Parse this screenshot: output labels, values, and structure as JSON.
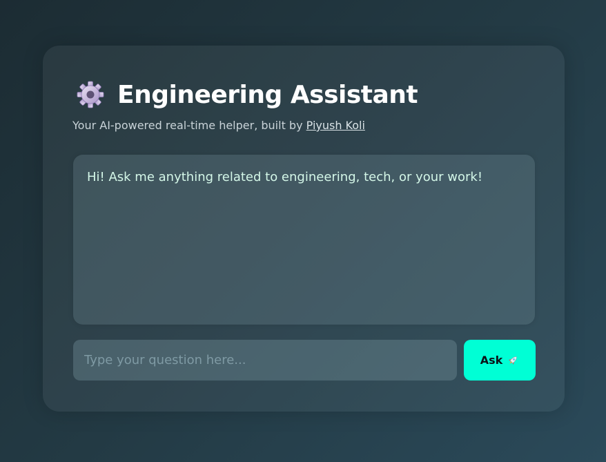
{
  "header": {
    "icon": "gear-icon",
    "title": "Engineering Assistant",
    "subtitle_prefix": "Your AI-powered real-time helper, built by ",
    "author_link": "Piyush Koli"
  },
  "chat": {
    "messages": [
      {
        "role": "assistant",
        "text": "Hi! Ask me anything related to engineering, tech, or your work!"
      }
    ]
  },
  "input": {
    "placeholder": "Type your question here...",
    "value": ""
  },
  "ask_button": {
    "label": "Ask",
    "icon": "rocket-icon"
  },
  "colors": {
    "accent": "#00ffd5",
    "message_text": "#d4f7e8",
    "title_text": "#ffffff"
  }
}
